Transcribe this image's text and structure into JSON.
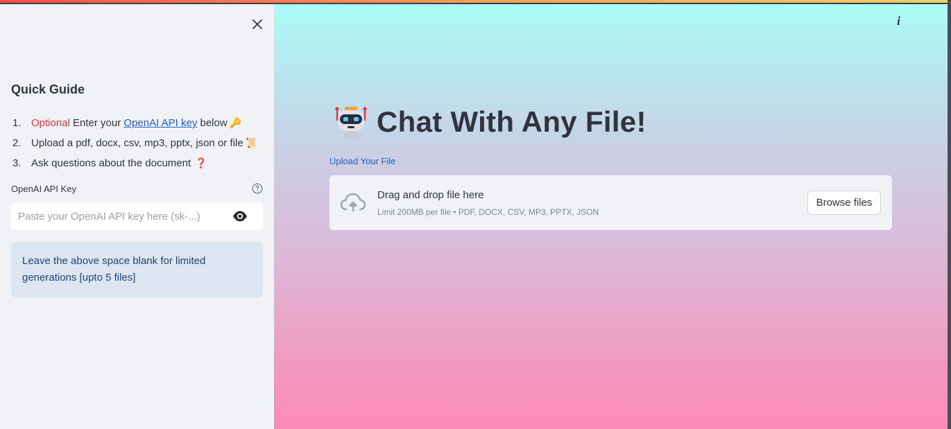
{
  "sidebar": {
    "guide_title": "Quick Guide",
    "steps": [
      {
        "num": "1.",
        "optional": "Optional",
        "pre": " Enter your ",
        "link": "OpenAI API key",
        "post": " below",
        "emoji": "🔑"
      },
      {
        "num": "2.",
        "text": "Upload a pdf, docx, csv, mp3, pptx, json or file",
        "emoji": "📜"
      },
      {
        "num": "3.",
        "text": "Ask questions about the document",
        "emoji": "❓"
      }
    ],
    "api_key_label": "OpenAI API Key",
    "api_key_placeholder": "Paste your OpenAI API key here (sk-...)",
    "info_text": "Leave the above space blank for limited generations [upto 5 files]"
  },
  "main": {
    "title": "Chat With Any File!",
    "upload_label": "Upload Your File",
    "drop_title": "Drag and drop file here",
    "drop_limit": "Limit 200MB per file • PDF, DOCX, CSV, MP3, PPTX, JSON",
    "browse_label": "Browse files"
  },
  "icons": {
    "close": "close-icon",
    "help": "help-circle-icon",
    "eye": "eye-icon",
    "info": "info-icon",
    "robot": "robot-icon",
    "cloud": "cloud-upload-icon"
  },
  "colors": {
    "accent_red": "#e0383e",
    "link_blue": "#2060c8",
    "info_text": "#1f4477",
    "info_bg": "#dce6f1",
    "sidebar_bg": "#f0f2f6"
  }
}
